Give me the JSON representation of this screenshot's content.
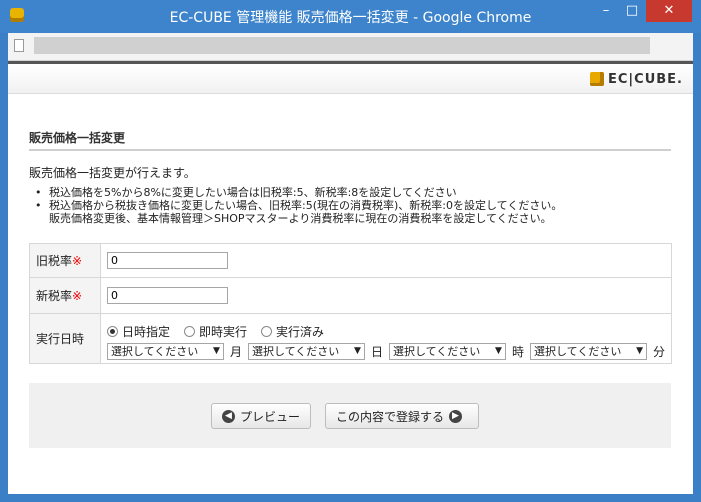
{
  "window": {
    "title": "EC-CUBE 管理機能 販売価格一括変更 - Google Chrome",
    "minimize": "–",
    "maximize": "□",
    "close": "✕"
  },
  "header": {
    "logo_text": "EC|CUBE."
  },
  "page": {
    "title": "販売価格一括変更",
    "description": "販売価格一括変更が行えます。",
    "notes": [
      "税込価格を5%から8%に変更したい場合は旧税率:5、新税率:8を設定してください",
      "税込価格から税抜き価格に変更したい場合、旧税率:5(現在の消費税率)、新税率:0を設定してください。",
      "販売価格変更後、基本情報管理＞SHOPマスターより消費税率に現在の消費税率を設定してください。"
    ]
  },
  "form": {
    "old_rate": {
      "label": "旧税率",
      "required_mark": "※",
      "value": "0"
    },
    "new_rate": {
      "label": "新税率",
      "required_mark": "※",
      "value": "0"
    },
    "execution": {
      "label": "実行日時",
      "options": [
        "日時指定",
        "即時実行",
        "実行済み"
      ],
      "selected": "日時指定",
      "month": {
        "value": "選択してください",
        "unit": "月"
      },
      "day": {
        "value": "選択してください",
        "unit": "日"
      },
      "hour": {
        "value": "選択してください",
        "unit": "時"
      },
      "minute": {
        "value": "選択してください",
        "unit": "分"
      }
    }
  },
  "actions": {
    "preview_label": "プレビュー",
    "register_label": "この内容で登録する"
  },
  "colors": {
    "titlebar": "#3d84cc",
    "close_button": "#c7392f",
    "required": "#ee0000"
  }
}
